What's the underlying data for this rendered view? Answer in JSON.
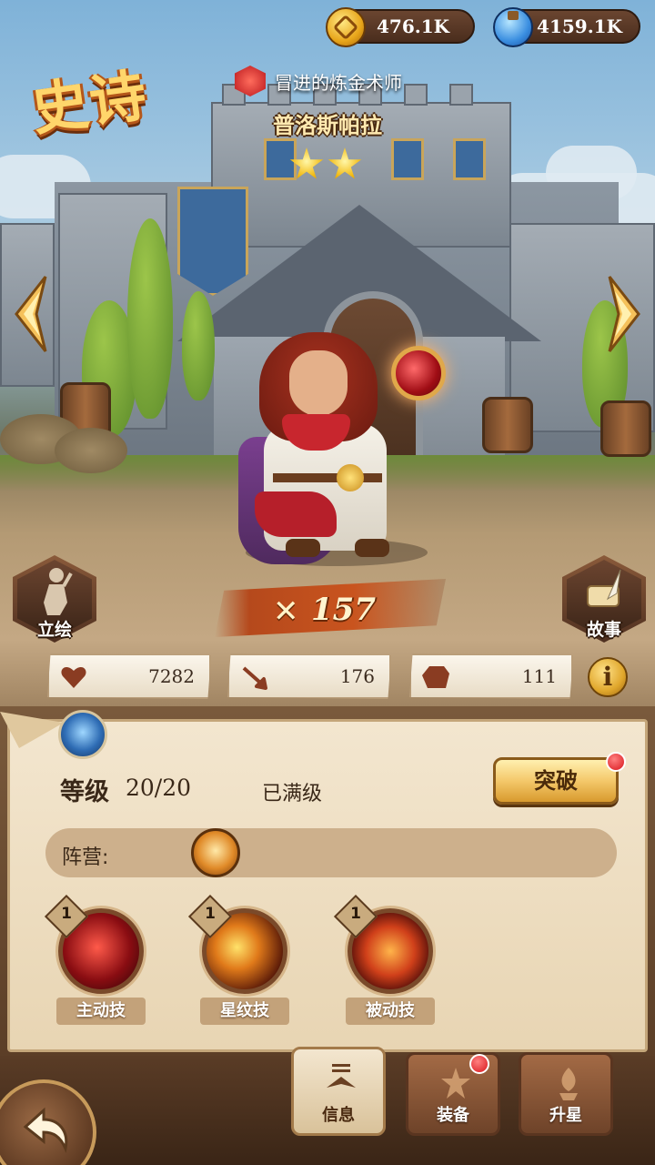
{
  "currency": {
    "gold": {
      "icon": "gold-coin-icon",
      "value": "476.1K"
    },
    "potion": {
      "icon": "blue-potion-icon",
      "value": "4159.1K"
    }
  },
  "hero": {
    "rarity": "史诗",
    "class_icon": "red-gem-icon",
    "class": "冒进的炼金术师",
    "name": "普洛斯帕拉",
    "stars": 2,
    "power_icon": "crossed-swords-icon",
    "power": "157"
  },
  "side_buttons": {
    "portrait": "立绘",
    "story": "故事"
  },
  "stats": {
    "hp": {
      "icon": "heart-icon",
      "value": "7282"
    },
    "attack": {
      "icon": "sword-icon",
      "value": "176"
    },
    "defense": {
      "icon": "shield-icon",
      "value": "111"
    },
    "info_label": "i"
  },
  "panel": {
    "level_label": "等级",
    "level_value": "20/20",
    "level_status": "已满级",
    "breakthrough": "突破",
    "camp_label": "阵营:",
    "skills": [
      {
        "level": "1",
        "name": "主动技"
      },
      {
        "level": "1",
        "name": "星纹技"
      },
      {
        "level": "1",
        "name": "被动技"
      }
    ]
  },
  "tabs": [
    {
      "label": "信息",
      "active": true
    },
    {
      "label": "装备",
      "active": false,
      "notify": true
    },
    {
      "label": "升星",
      "active": false
    }
  ],
  "colors": {
    "accent_gold": "#f4c86a",
    "notify_red": "#d8161c",
    "parchment": "#f3e6cf"
  }
}
